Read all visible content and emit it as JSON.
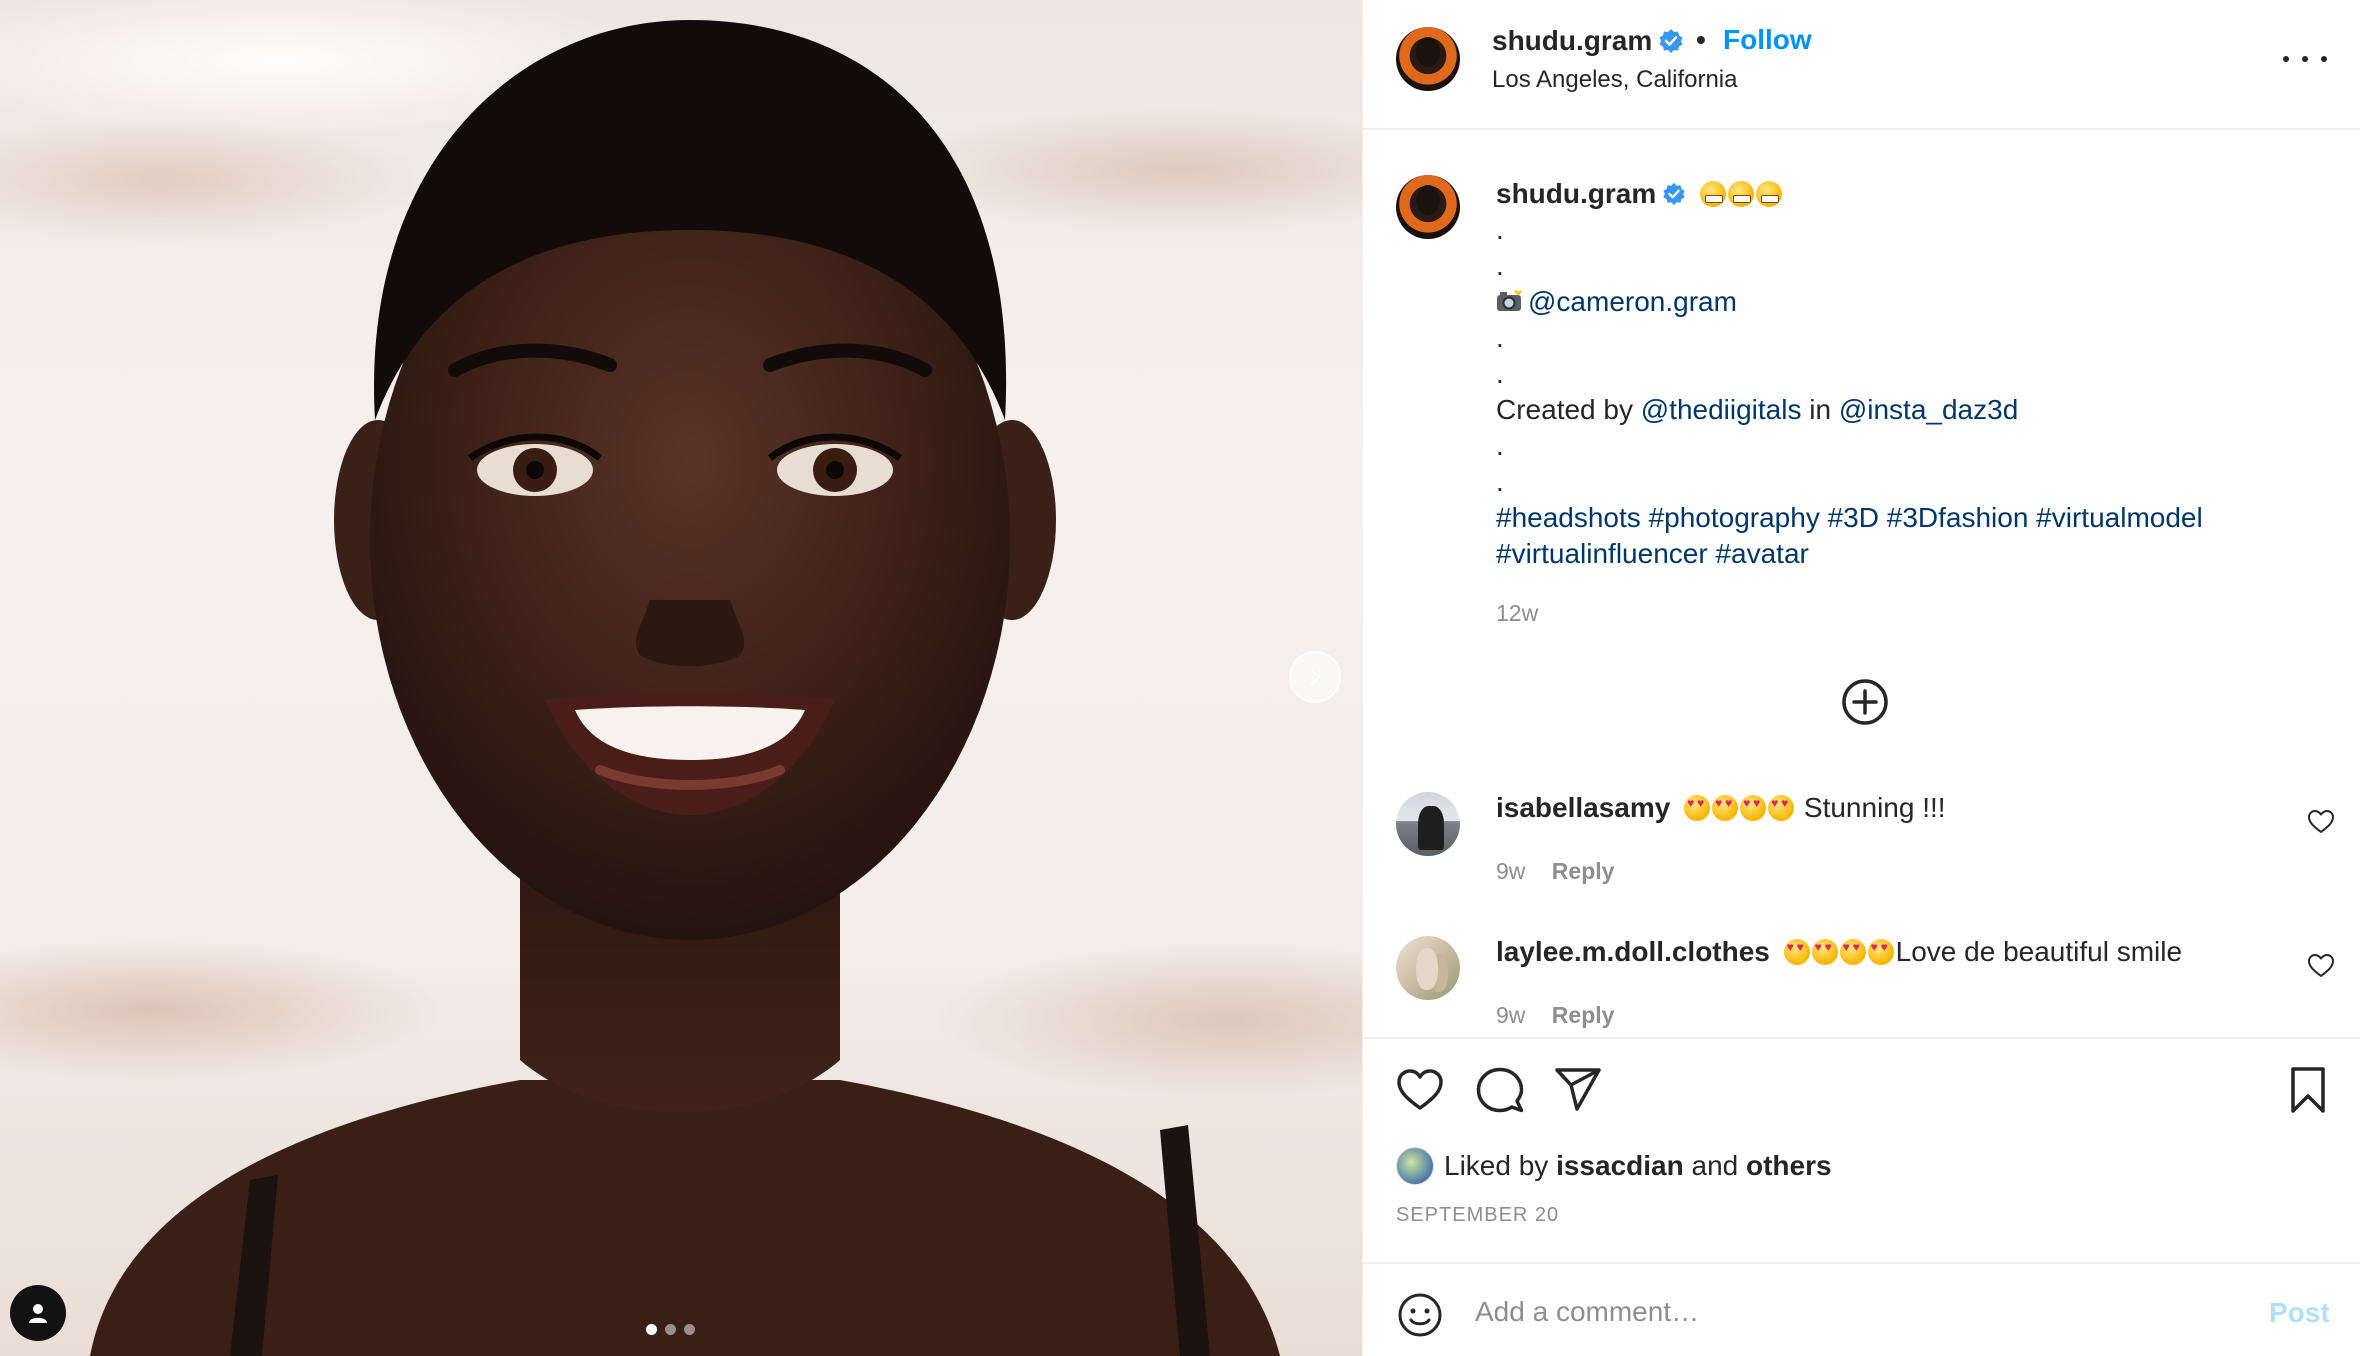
{
  "post": {
    "username": "shudu.gram",
    "location": "Los Angeles, California",
    "follow_label": "Follow",
    "separator": "•",
    "verified_icon": "verified-badge-icon",
    "more_icon": "more-options-icon"
  },
  "media": {
    "carousel_count": 3,
    "active_slide": 1,
    "next_icon": "chevron-right-icon",
    "tag_icon": "user-tag-icon"
  },
  "caption": {
    "username": "shudu.gram",
    "lines": [
      ".",
      ".",
      "@cameron.gram",
      ".",
      "."
    ],
    "created_prefix": "Created by",
    "creator_handle": "@thediigitals",
    "in_word": "in",
    "tool_handle": "@insta_daz3d",
    "dots_after": [
      ".",
      "."
    ],
    "hashtags_line1": "#headshots #photography #3D #3Dfashion #virtualmodel",
    "hashtags_line2": "#virtualinfluencer #avatar",
    "time": "12w"
  },
  "comments": [
    {
      "username": "isabellasamy",
      "text": "Stunning !!!",
      "time": "9w",
      "reply_label": "Reply"
    },
    {
      "username": "laylee.m.doll.clothes",
      "text": "Love de beautiful smile",
      "time": "9w",
      "reply_label": "Reply"
    }
  ],
  "likes": {
    "prefix": "Liked by",
    "user": "issacdian",
    "and_word": "and",
    "others": "others",
    "date": "SEPTEMBER 20"
  },
  "add_comment": {
    "placeholder": "Add a comment…",
    "post_label": "Post"
  },
  "colors": {
    "accent": "#0095f6",
    "link": "#00376b",
    "muted": "#8e8e8e",
    "post_disabled": "#b2dffc"
  }
}
